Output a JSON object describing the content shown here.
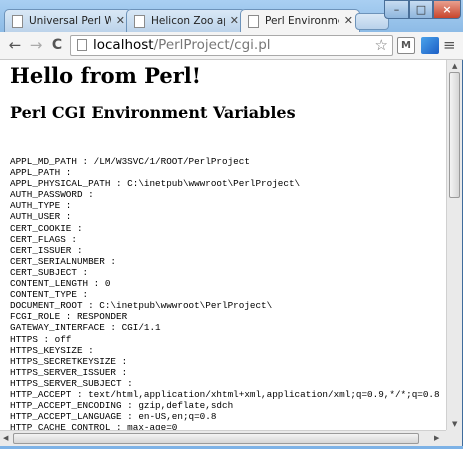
{
  "tabs": [
    {
      "label": "Universal Perl Web A",
      "active": false
    },
    {
      "label": "Helicon Zoo applicat",
      "active": false
    },
    {
      "label": "Perl Environment Var",
      "active": true
    }
  ],
  "toolbar": {
    "back": "←",
    "forward": "→",
    "reload": "C",
    "url_host": "localhost",
    "url_path": "/PerlProject/cgi.pl",
    "star": "☆",
    "ext_m": "M",
    "menu": "≡"
  },
  "window_buttons": {
    "minimize": "–",
    "maximize": "□",
    "close": "×"
  },
  "page": {
    "heading": "Hello from Perl!",
    "subheading": "Perl CGI Environment Variables",
    "variables": [
      "APPL_MD_PATH : /LM/W3SVC/1/ROOT/PerlProject",
      "APPL_PATH :",
      "APPL_PHYSICAL_PATH : C:\\inetpub\\wwwroot\\PerlProject\\",
      "AUTH_PASSWORD :",
      "AUTH_TYPE :",
      "AUTH_USER :",
      "CERT_COOKIE :",
      "CERT_FLAGS :",
      "CERT_ISSUER :",
      "CERT_SERIALNUMBER :",
      "CERT_SUBJECT :",
      "CONTENT_LENGTH : 0",
      "CONTENT_TYPE :",
      "DOCUMENT_ROOT : C:\\inetpub\\wwwroot\\PerlProject\\",
      "FCGI_ROLE : RESPONDER",
      "GATEWAY_INTERFACE : CGI/1.1",
      "HTTPS : off",
      "HTTPS_KEYSIZE :",
      "HTTPS_SECRETKEYSIZE :",
      "HTTPS_SERVER_ISSUER :",
      "HTTPS_SERVER_SUBJECT :",
      "HTTP_ACCEPT : text/html,application/xhtml+xml,application/xml;q=0.9,*/*;q=0.8",
      "HTTP_ACCEPT_ENCODING : gzip,deflate,sdch",
      "HTTP_ACCEPT_LANGUAGE : en-US,en;q=0.8",
      "HTTP_CACHE_CONTROL : max-age=0"
    ]
  },
  "colors": {
    "frame": "#7db2e6",
    "close_button": "#c8452c"
  }
}
